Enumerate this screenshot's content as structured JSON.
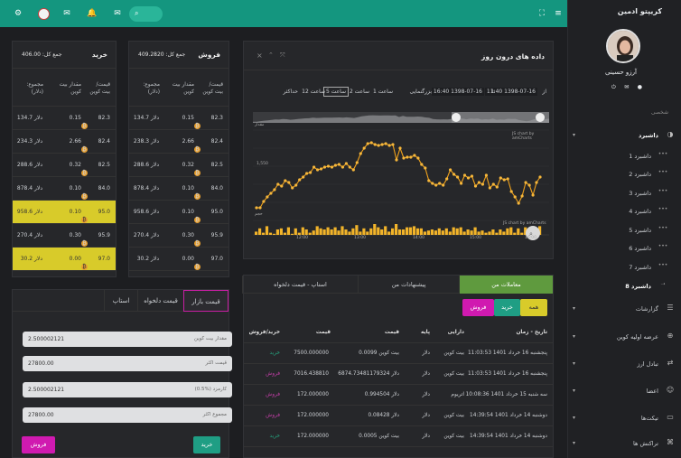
{
  "sidebar": {
    "brand": "کریپتو ادمین",
    "user": "آرزو حسینی",
    "section": "شخصی",
    "items": [
      {
        "label": "داشبرد",
        "icon": "dashboard-icon"
      },
      {
        "label": "داشبرد 1"
      },
      {
        "label": "داشبرد 2"
      },
      {
        "label": "داشبرد 3"
      },
      {
        "label": "داشبرد 4"
      },
      {
        "label": "داشبرد 5"
      },
      {
        "label": "داشبرد 6"
      },
      {
        "label": "داشبرد 7"
      },
      {
        "label": "داشبرد 8"
      },
      {
        "label": "گزارشات"
      },
      {
        "label": "عرضه اولیه کوین"
      },
      {
        "label": "تبادل ارز"
      },
      {
        "label": "اعضا"
      },
      {
        "label": "تیکت‌ها"
      },
      {
        "label": "تراکنش ها"
      }
    ]
  },
  "sell_book": {
    "title": "فروش",
    "total": "جمع کل: 409.2820",
    "headers": [
      "قیمت/ بیت کوین",
      "مقدار بیت کوین",
      "مجموع: (دلار)"
    ],
    "rows": [
      {
        "price": "82.3",
        "amount": "0.15",
        "total": "134.7 دلار",
        "hl": false
      },
      {
        "price": "82.4",
        "amount": "2.66",
        "total": "238.3 دلار",
        "hl": false
      },
      {
        "price": "82.5",
        "amount": "0.32",
        "total": "288.6 دلار",
        "hl": false
      },
      {
        "price": "84.0",
        "amount": "0.10",
        "total": "878.4 دلار",
        "hl": false
      },
      {
        "price": "95.0",
        "amount": "0.10",
        "total": "958.6 دلار",
        "hl": false
      },
      {
        "price": "95.9",
        "amount": "0.30",
        "total": "270.4 دلار",
        "hl": false
      },
      {
        "price": "97.0",
        "amount": "0.00",
        "total": "30.2 دلار",
        "hl": false
      }
    ]
  },
  "buy_book": {
    "title": "خرید",
    "total": "جمع کل: 406.00",
    "headers": [
      "قیمت/ بیت کوین",
      "مقدار بیت کوین",
      "مجموع: (دلار)"
    ],
    "rows": [
      {
        "price": "82.3",
        "amount": "0.15",
        "total": "134.7 دلار",
        "hl": false
      },
      {
        "price": "82.4",
        "amount": "2.66",
        "total": "234.3 دلار",
        "hl": false
      },
      {
        "price": "82.5",
        "amount": "0.32",
        "total": "288.6 دلار",
        "hl": false
      },
      {
        "price": "84.0",
        "amount": "0.10",
        "total": "878.4 دلار",
        "hl": false
      },
      {
        "price": "95.0",
        "amount": "0.10",
        "total": "958.6 دلار",
        "hl": true
      },
      {
        "price": "95.9",
        "amount": "0.30",
        "total": "270.4 دلار",
        "hl": false
      },
      {
        "price": "97.0",
        "amount": "0.00",
        "total": "30.2 دلار",
        "hl": true
      }
    ]
  },
  "order_form": {
    "tabs": [
      "قیمت بازار",
      "قیمت دلخواه",
      "استاپ"
    ],
    "fields": [
      {
        "value": "2.500002121",
        "placeholder": "مقدار بیت کوین"
      },
      {
        "value": "27800.00",
        "placeholder": "قیمت اکثر"
      },
      {
        "value": "2.500002121",
        "placeholder": "کارمزد (%0.5)"
      },
      {
        "value": "27800.00",
        "placeholder": "مجموع اکثر"
      }
    ],
    "buy_label": "خرید",
    "sell_label": "فروش",
    "buy_color": "#1f9e84",
    "sell_color": "#d01ab0"
  },
  "chart_panel": {
    "title": "داده های درون روز",
    "from_date": "11:40 1398-07-16",
    "to_date": "16:40 1398-07-16",
    "from_label": "از",
    "to_label": "تا",
    "zoom_label": "بزرگنمایی",
    "zoom_options": [
      "1 ساعت",
      "2 ساعت",
      "5 ساعت",
      "12 ساعت",
      "حداکثر"
    ],
    "zoom_selected": "5 ساعت",
    "credit1": "JS chart by amCharts",
    "credit2": "JS chart by amCharts",
    "value_axis_label": "مقدار",
    "volume_axis_label": "حجم",
    "y_tick": "1,550",
    "x_ticks": [
      "12:00",
      "13:00",
      "14:00",
      "15:00",
      "16:00"
    ]
  },
  "chart_data": {
    "type": "line",
    "x_labels": [
      "12:00",
      "13:00",
      "14:00",
      "15:00",
      "16:00"
    ],
    "series": [
      {
        "values": [
          2,
          2,
          9,
          14,
          18,
          22,
          28,
          26,
          32,
          30,
          24,
          27,
          33,
          36,
          40,
          41,
          47,
          44,
          45,
          47,
          48,
          47,
          49,
          50,
          47,
          51,
          47,
          44,
          52,
          62,
          68,
          73,
          74,
          72,
          71,
          72,
          73,
          71,
          72,
          55,
          68,
          57,
          58,
          58,
          60,
          57,
          50,
          46,
          32,
          29,
          27,
          29,
          27,
          34,
          44,
          39,
          36,
          29,
          38,
          35,
          37,
          26,
          30,
          28,
          38,
          24,
          28,
          25,
          35,
          33,
          34,
          20,
          14,
          7,
          15,
          30,
          27,
          16,
          30,
          36
        ]
      },
      {
        "values": [
          3,
          6,
          2,
          8,
          2,
          1,
          5,
          6,
          2,
          7,
          1,
          6,
          2,
          7,
          5,
          2,
          4,
          8,
          6,
          5,
          7,
          5,
          7,
          4,
          8,
          5,
          3,
          6,
          9,
          3,
          6,
          3,
          6,
          10,
          7,
          5,
          8,
          3,
          6,
          10,
          5,
          5,
          7,
          7,
          8,
          6,
          6,
          3,
          4,
          5,
          4,
          6,
          4,
          6,
          3,
          7,
          6,
          7,
          3,
          5,
          4,
          7,
          3,
          4,
          2,
          3,
          5,
          2,
          5,
          3,
          6,
          7,
          2,
          6,
          2,
          7,
          5,
          2,
          6,
          8
        ]
      }
    ],
    "grid": true
  },
  "trades": {
    "tabs": [
      "معاملات من",
      "پیشنهادات من",
      "استاپ - قیمت دلخواه"
    ],
    "filters": [
      "همه",
      "خرید",
      "فروش"
    ],
    "filter_colors": [
      "#d8cb2a",
      "#1f9e84",
      "#d01ab0"
    ],
    "headers": [
      "تاریخ - زمان",
      "دارایی",
      "پایه",
      "قیمت",
      "قیمت",
      "خرید/فروش"
    ],
    "rows": [
      {
        "date": "پنجشنبه 16 خرداد 1401 11:03:53",
        "asset": "بیت کوین",
        "base": "دلار",
        "p1": "0.0099 بیت کوین",
        "p2": "7500.000000",
        "type": "خرید",
        "buy": true
      },
      {
        "date": "پنجشنبه 16 خرداد 1401 11:03:53",
        "asset": "بیت کوین",
        "base": "دلار",
        "p1": "6874.73481179324 دلار",
        "p2": "7016.438810",
        "type": "فروش",
        "buy": false
      },
      {
        "date": "سه شنبه 15 خرداد 1401 10:08:36",
        "asset": "اتریوم",
        "base": "دلار",
        "p1": "0.994504 دلار",
        "p2": "172.000000",
        "type": "فروش",
        "buy": false
      },
      {
        "date": "دوشنبه 14 خرداد 1401 14:39:54",
        "asset": "بیت کوین",
        "base": "دلار",
        "p1": "0.08428 دلار",
        "p2": "172.000000",
        "type": "فروش",
        "buy": false
      },
      {
        "date": "دوشنبه 14 خرداد 1401 14:39:54",
        "asset": "بیت کوین",
        "base": "دلار",
        "p1": "0.0005 بیت کوین",
        "p2": "172.000000",
        "type": "خرید",
        "buy": true
      }
    ]
  }
}
